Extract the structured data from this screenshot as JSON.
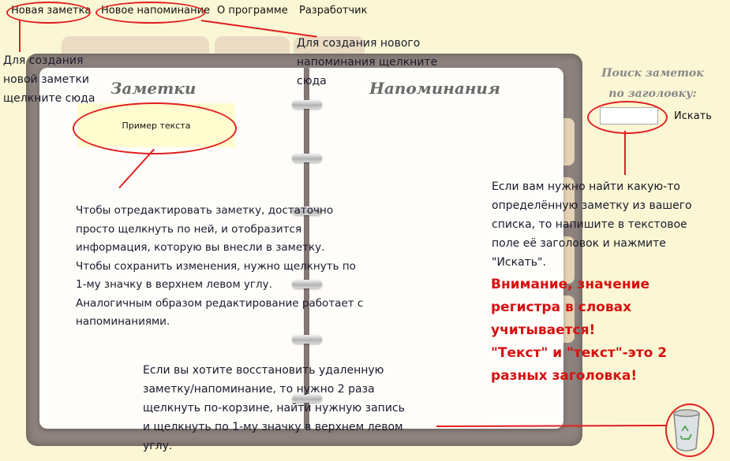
{
  "menu": {
    "new_note": "Новая заметка",
    "new_reminder": "Новое напоминание",
    "about": "О программе",
    "developer": "Разработчик"
  },
  "notebook": {
    "notes_title": "Заметки",
    "reminders_title": "Напоминания",
    "sample_note": "Пример текста"
  },
  "search": {
    "label_line1": "Поиск заметок",
    "label_line2": "по заголовку:",
    "input_value": "",
    "button_label": "Искать"
  },
  "annotations": {
    "new_note_hint": [
      "Для создания",
      "новой заметки",
      "щелкните сюда"
    ],
    "new_reminder_hint": [
      "Для создания нового",
      "напоминания щелкните",
      "сюда"
    ],
    "edit_hint": [
      "Чтобы отредактировать заметку, достаточно",
      "просто щелкнуть по ней, и отобразится",
      "информация, которую вы внесли в заметку.",
      "Чтобы сохранить изменения, нужно щелкнуть по",
      "1-му значку в верхнем левом углу.",
      "Аналогичным образом редактирование работает с",
      "напоминаниями."
    ],
    "search_hint": [
      "Если вам нужно найти какую-то",
      "определённую заметку из вашего",
      "списка, то напишите в текстовое",
      "поле её заголовок и нажмите",
      "\"Искать\"."
    ],
    "warning": [
      "Внимание, значение",
      "регистра в словах",
      "учитывается!",
      "\"Текст\" и \"текст\"-это 2",
      "разных заголовка!"
    ],
    "restore_hint": [
      "Если вы хотите восстановить удаленную",
      "заметку/напоминание, то нужно 2 раза",
      "щелкнуть по-корзине, найти нужную запись",
      "и щелкнуть по 1-му значку в верхнем левом",
      "углу."
    ]
  },
  "colors": {
    "background": "#fbf7d5",
    "annotation_red": "#e02020",
    "warning_red": "#d61010"
  },
  "icons": {
    "trash": "recycle-bin-icon"
  }
}
